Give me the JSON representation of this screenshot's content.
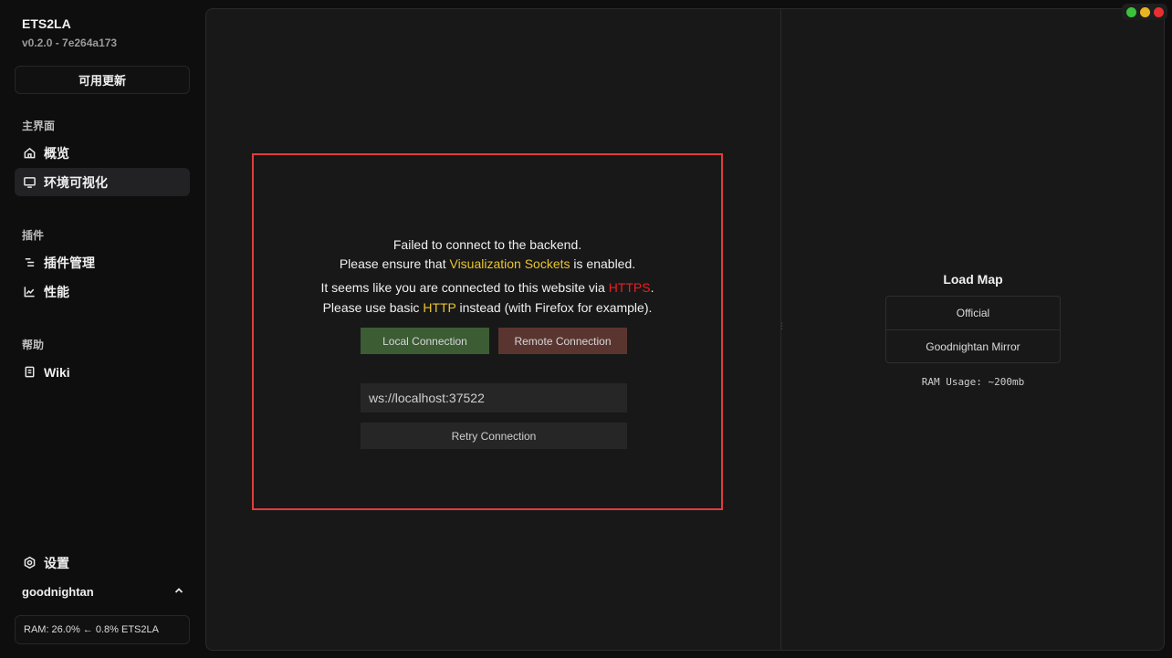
{
  "app": {
    "title": "ETS2LA",
    "version": "v0.2.0 - 7e264a173"
  },
  "sidebar": {
    "update_label": "可用更新",
    "sections": [
      {
        "label": "主界面"
      },
      {
        "label": "插件"
      },
      {
        "label": "帮助"
      }
    ],
    "items": [
      {
        "label": "概览",
        "icon": "home-icon"
      },
      {
        "label": "环境可视化",
        "icon": "monitor-icon",
        "active": true
      },
      {
        "label": "插件管理",
        "icon": "list-icon"
      },
      {
        "label": "性能",
        "icon": "chart-icon"
      },
      {
        "label": "Wiki",
        "icon": "book-icon"
      },
      {
        "label": "设置",
        "icon": "gear-icon"
      }
    ],
    "user": "goodnightan",
    "ram_status": "RAM: 26.0% ← 0.8% ETS2LA"
  },
  "dialog": {
    "line1": "Failed to connect to the backend.",
    "line2_pre": "Please ensure that ",
    "line2_hl": "Visualization Sockets",
    "line2_post": " is enabled.",
    "line3_pre": "It seems like you are connected to this website via ",
    "line3_hl": "HTTPS",
    "line3_post": ".",
    "line4_pre": "Please use basic ",
    "line4_hl": "HTTP",
    "line4_post": " instead (with Firefox for example).",
    "local_btn": "Local Connection",
    "remote_btn": "Remote Connection",
    "ws_value": "ws://localhost:37522",
    "retry_btn": "Retry Connection"
  },
  "load_map": {
    "title": "Load Map",
    "options": [
      "Official",
      "Goodnightan Mirror"
    ],
    "ram_usage": "RAM Usage: ~200mb"
  },
  "colors": {
    "accent_yellow": "#e8c530",
    "accent_red": "#e82020",
    "dialog_border": "#e23c3c",
    "local_btn_bg": "#3c5c34",
    "remote_btn_bg": "#5a3530",
    "win_green": "#3bc43b",
    "win_yellow": "#e8b420",
    "win_red": "#e83030"
  }
}
